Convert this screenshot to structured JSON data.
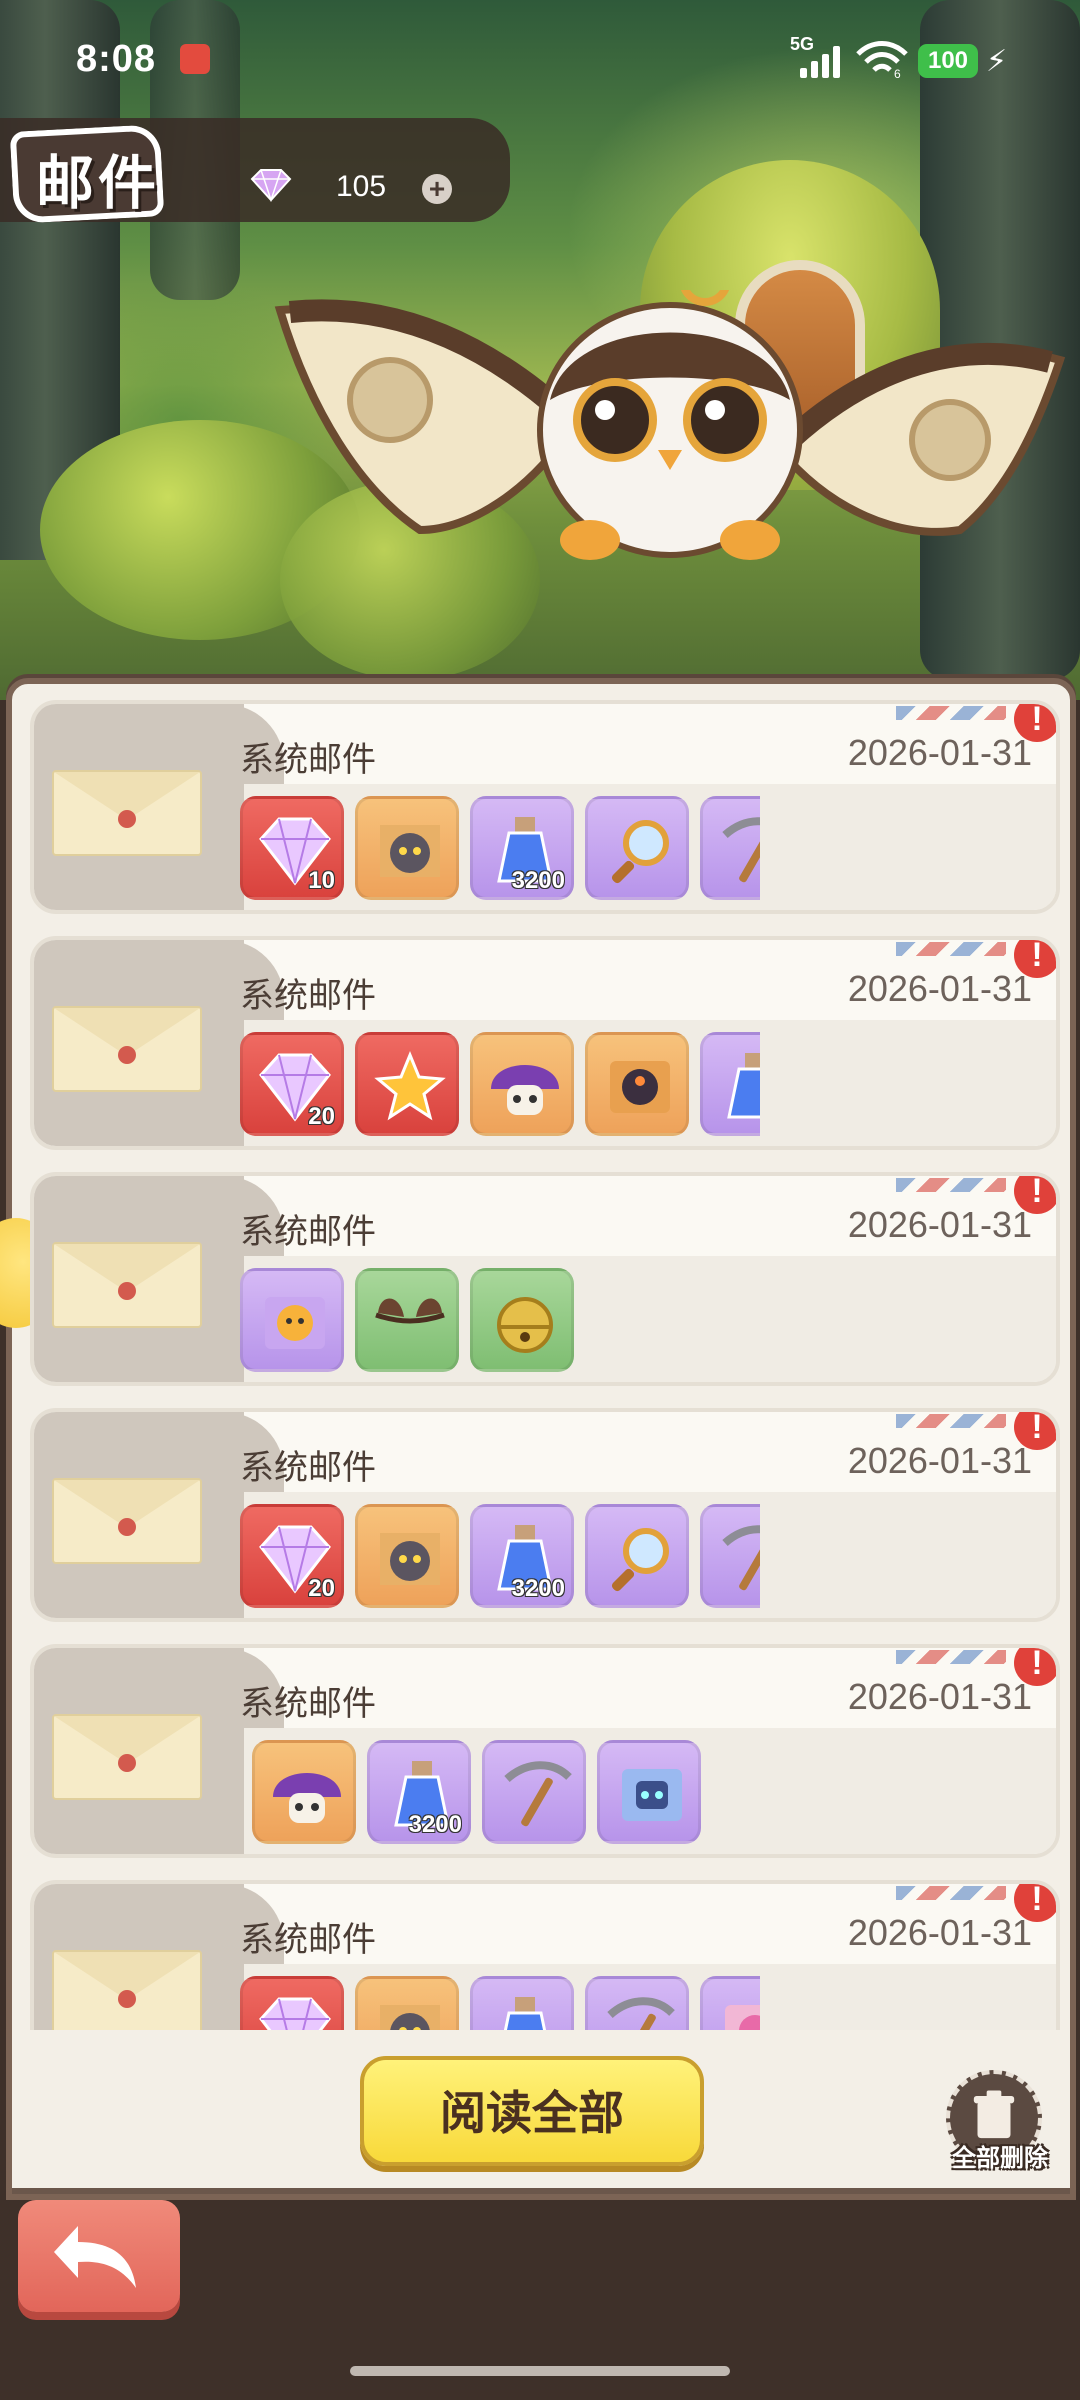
{
  "status_bar": {
    "time": "8:08",
    "network": "5G",
    "wifi_badge": "6",
    "battery": "100"
  },
  "header": {
    "title": "邮件",
    "gem_count": "105",
    "plus_label": "+"
  },
  "mails": [
    {
      "title": "系统邮件",
      "date": "2026-01-31",
      "unread_mark": "!",
      "items": [
        {
          "icon": "diamond-icon",
          "rarity": "red",
          "qty": "10"
        },
        {
          "icon": "cat-puzzle-icon",
          "rarity": "orange",
          "qty": ""
        },
        {
          "icon": "potion-icon",
          "rarity": "purple",
          "qty": "3200"
        },
        {
          "icon": "magnifier-icon",
          "rarity": "purple",
          "qty": ""
        },
        {
          "icon": "pickaxe-icon",
          "rarity": "purple",
          "qty": ""
        }
      ]
    },
    {
      "title": "系统邮件",
      "date": "2026-01-31",
      "unread_mark": "!",
      "items": [
        {
          "icon": "diamond-icon",
          "rarity": "red",
          "qty": "20"
        },
        {
          "icon": "star-puzzle-icon",
          "rarity": "red",
          "qty": ""
        },
        {
          "icon": "mushroom-icon",
          "rarity": "orange",
          "qty": ""
        },
        {
          "icon": "bird-puzzle-icon",
          "rarity": "orange",
          "qty": ""
        },
        {
          "icon": "potion-icon",
          "rarity": "purple",
          "qty": "3"
        }
      ]
    },
    {
      "title": "系统邮件",
      "date": "2026-01-31",
      "unread_mark": "!",
      "items": [
        {
          "icon": "chick-puzzle-icon",
          "rarity": "purple",
          "qty": ""
        },
        {
          "icon": "ears-icon",
          "rarity": "green",
          "qty": ""
        },
        {
          "icon": "bell-icon",
          "rarity": "green",
          "qty": ""
        }
      ]
    },
    {
      "title": "系统邮件",
      "date": "2026-01-31",
      "unread_mark": "!",
      "items": [
        {
          "icon": "diamond-icon",
          "rarity": "red",
          "qty": "20"
        },
        {
          "icon": "cat-puzzle-icon",
          "rarity": "orange",
          "qty": ""
        },
        {
          "icon": "potion-icon",
          "rarity": "purple",
          "qty": "3200"
        },
        {
          "icon": "magnifier-icon",
          "rarity": "purple",
          "qty": ""
        },
        {
          "icon": "pickaxe-icon",
          "rarity": "purple",
          "qty": ""
        }
      ]
    },
    {
      "title": "系统邮件",
      "date": "2026-01-31",
      "unread_mark": "!",
      "items": [
        {
          "icon": "mushroom-icon",
          "rarity": "orange",
          "qty": ""
        },
        {
          "icon": "potion-icon",
          "rarity": "purple",
          "qty": "3200"
        },
        {
          "icon": "pickaxe-icon",
          "rarity": "purple",
          "qty": ""
        },
        {
          "icon": "robot-puzzle-icon",
          "rarity": "purple",
          "qty": ""
        }
      ]
    },
    {
      "title": "系统邮件",
      "date": "2026-01-31",
      "unread_mark": "!",
      "items": [
        {
          "icon": "diamond-icon",
          "rarity": "red",
          "qty": ""
        },
        {
          "icon": "cat-puzzle-icon",
          "rarity": "orange",
          "qty": ""
        },
        {
          "icon": "potion-icon",
          "rarity": "purple",
          "qty": ""
        },
        {
          "icon": "pickaxe-icon",
          "rarity": "purple",
          "qty": ""
        },
        {
          "icon": "pink-puzzle-icon",
          "rarity": "purple",
          "qty": ""
        }
      ]
    }
  ],
  "actions": {
    "read_all": "阅读全部",
    "delete_all": "全部删除",
    "back_icon": "back-arrow-icon"
  },
  "colors": {
    "panel_bg": "#f3efe7",
    "panel_border": "#7c6455",
    "read_all_button": "#f8d93a",
    "back_button": "#e2665a",
    "alert_badge": "#e0413a"
  }
}
